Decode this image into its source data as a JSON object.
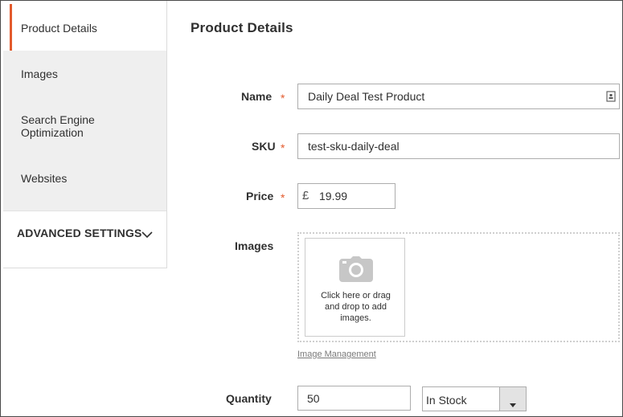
{
  "sidebar": {
    "items": [
      {
        "label": "Product Details",
        "active": true
      },
      {
        "label": "Images",
        "active": false
      },
      {
        "label": "Search Engine\nOptimization",
        "active": false
      },
      {
        "label": "Websites",
        "active": false
      }
    ],
    "advanced_label": "ADVANCED SETTINGS",
    "advanced_icon": "chevron-down-icon"
  },
  "page": {
    "title": "Product Details"
  },
  "form": {
    "name_label": "Name",
    "name_value": "Daily Deal Test Product",
    "sku_label": "SKU",
    "sku_value": "test-sku-daily-deal",
    "price_label": "Price",
    "currency_symbol": "£",
    "price_value": "19.99",
    "images_label": "Images",
    "upload_text": "Click here or drag\nand drop to add\nimages.",
    "image_management_link": "Image Management",
    "quantity_label": "Quantity",
    "quantity_value": "50",
    "stock_status": "In Stock",
    "required_mark": "*"
  },
  "colors": {
    "accent": "#e35a2c",
    "sidebar_bg": "#efefef"
  }
}
